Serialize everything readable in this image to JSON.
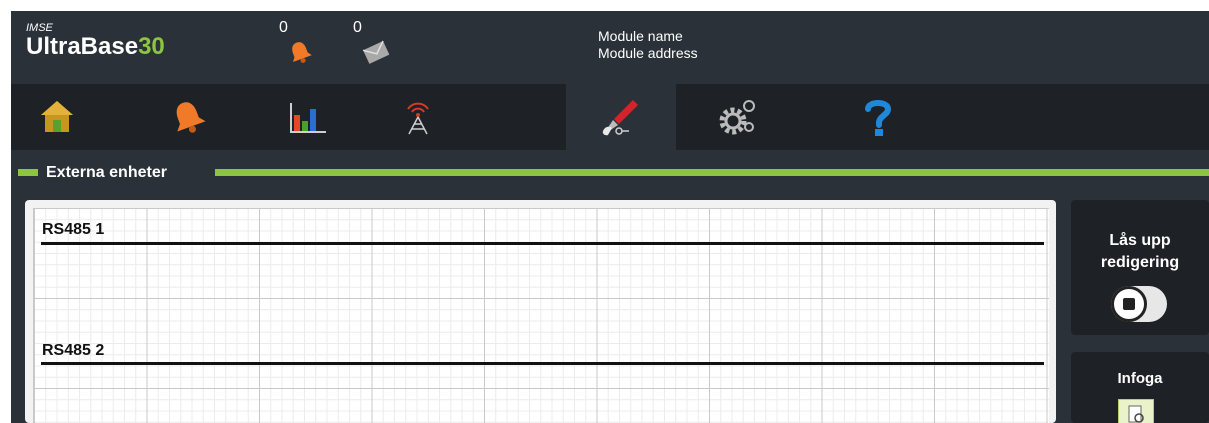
{
  "header": {
    "brand_small": "IMSE",
    "brand_main": "UltraBase",
    "brand_num": "30",
    "alarm_count": "0",
    "message_count": "0",
    "module_name": "Module name",
    "module_address": "Module address"
  },
  "nav": {
    "items": [
      {
        "icon": "home-icon"
      },
      {
        "icon": "bell-icon"
      },
      {
        "icon": "chart-icon"
      },
      {
        "icon": "antenna-icon"
      },
      {
        "icon": "tools-icon",
        "active": true
      },
      {
        "icon": "gears-icon"
      },
      {
        "icon": "help-icon"
      }
    ]
  },
  "section": {
    "title": "Externa enheter"
  },
  "buses": [
    {
      "label": "RS485 1"
    },
    {
      "label": "RS485 2"
    }
  ],
  "side": {
    "unlock_label": "Lås upp redigering",
    "insert_label": "Infoga"
  },
  "colors": {
    "accent": "#8cc63f",
    "header_bg": "#2b3138",
    "nav_bg": "#1e2226",
    "alarm_orange": "#f07a2a",
    "help_blue": "#1f88d8"
  }
}
